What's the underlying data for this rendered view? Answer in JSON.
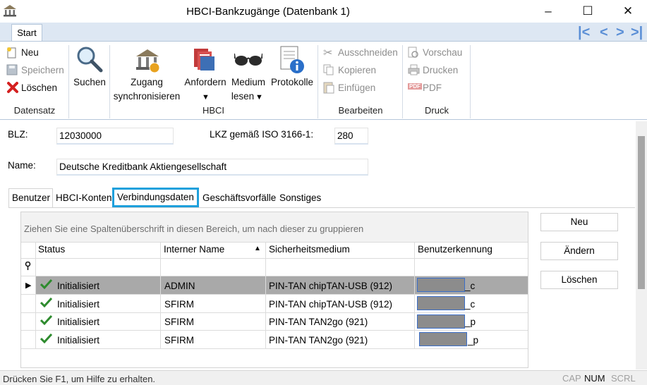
{
  "window": {
    "title": "HBCI-Bankzugänge (Datenbank 1)",
    "minimize": "–",
    "maximize": "☐",
    "close": "✕"
  },
  "ribbon": {
    "tab_start": "Start",
    "nav": {
      "first": "|<",
      "prev": "<",
      "next": ">",
      "last": ">|"
    },
    "datensatz": {
      "neu": "Neu",
      "speichern": "Speichern",
      "loeschen": "Löschen",
      "group": "Datensatz"
    },
    "suchen": "Suchen",
    "hbci": {
      "zugang_line1": "Zugang",
      "zugang_line2": "synchronisieren",
      "anfordern": "Anfordern",
      "medium_line1": "Medium",
      "medium_line2": "lesen",
      "protokolle": "Protokolle",
      "group": "HBCI"
    },
    "bearbeiten": {
      "ausschneiden": "Ausschneiden",
      "kopieren": "Kopieren",
      "einfuegen": "Einfügen",
      "group": "Bearbeiten"
    },
    "druck": {
      "vorschau": "Vorschau",
      "drucken": "Drucken",
      "pdf": "PDF",
      "pdf_icon": "PDF",
      "group": "Druck"
    }
  },
  "form": {
    "blz_label": "BLZ:",
    "blz_value": "12030000",
    "lkz_label": "LKZ gemäß ISO 3166-1:",
    "lkz_value": "280",
    "name_label": "Name:",
    "name_value": "Deutsche Kreditbank Aktiengesellschaft"
  },
  "tabs": [
    "Benutzer",
    "HBCI-Konten",
    "Verbindungsdaten",
    "Geschäftsvorfälle",
    "Sonstiges"
  ],
  "grid": {
    "group_hint": "Ziehen Sie eine Spaltenüberschrift in diesen Bereich, um nach dieser zu gruppieren",
    "columns": [
      "Status",
      "Interner Name",
      "Sicherheitsmedium",
      "Benutzerkennung"
    ],
    "sort_indicator": "▲",
    "filter_icon": "filter-icon",
    "rows": [
      {
        "status": "Initialisiert",
        "name": "ADMIN",
        "medium": "PIN-TAN chipTAN-USB (912)",
        "suffix": "_c"
      },
      {
        "status": "Initialisiert",
        "name": "SFIRM",
        "medium": "PIN-TAN chipTAN-USB (912)",
        "suffix": "_c"
      },
      {
        "status": "Initialisiert",
        "name": "SFIRM",
        "medium": "PIN-TAN TAN2go (921)",
        "suffix": "_p"
      },
      {
        "status": "Initialisiert",
        "name": "SFIRM",
        "medium": "PIN-TAN TAN2go (921)",
        "suffix": "_p"
      }
    ]
  },
  "side_buttons": {
    "neu": "Neu",
    "aendern": "Ändern",
    "loeschen": "Löschen"
  },
  "statusbar": {
    "text": "Drücken Sie F1, um Hilfe zu erhalten.",
    "cap": "CAP",
    "num": "NUM",
    "scrl": "SCRL"
  },
  "colors": {
    "tab_highlight": "#1ea0dc",
    "selected_row": "#a9a9a9",
    "ribbon_tabrow": "#dde7f3",
    "check": "#2e8b2e"
  }
}
